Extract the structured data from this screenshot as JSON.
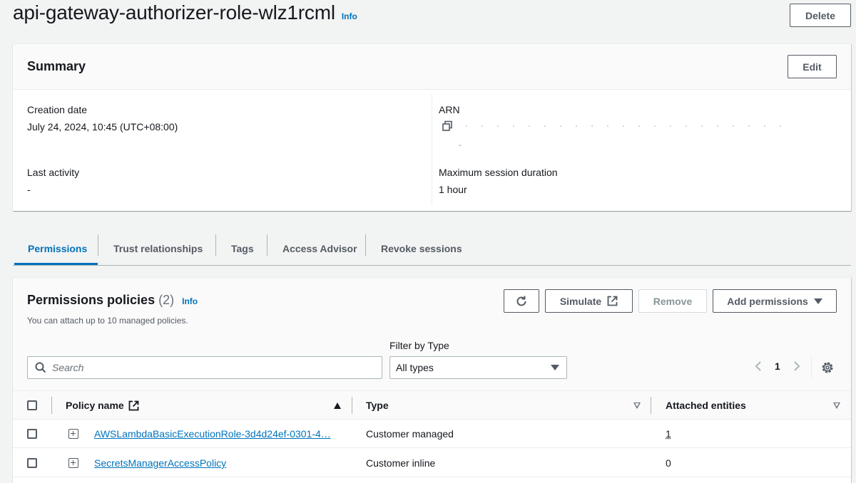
{
  "header": {
    "title": "api-gateway-authorizer-role-wlz1rcml",
    "info": "Info",
    "delete_label": "Delete"
  },
  "summary": {
    "title": "Summary",
    "edit_label": "Edit",
    "creation_date_label": "Creation date",
    "creation_date_value": "July 24, 2024, 10:45 (UTC+08:00)",
    "last_activity_label": "Last activity",
    "last_activity_value": "-",
    "arn_label": "ARN",
    "max_session_label": "Maximum session duration",
    "max_session_value": "1 hour"
  },
  "tabs": [
    {
      "label": "Permissions",
      "active": true
    },
    {
      "label": "Trust relationships"
    },
    {
      "label": "Tags"
    },
    {
      "label": "Access Advisor"
    },
    {
      "label": "Revoke sessions"
    }
  ],
  "policies": {
    "title": "Permissions policies",
    "count": "(2)",
    "info": "Info",
    "description": "You can attach up to 10 managed policies.",
    "simulate_label": "Simulate",
    "remove_label": "Remove",
    "add_permissions_label": "Add permissions",
    "filter_label": "Filter by Type",
    "search_placeholder": "Search",
    "filter_value": "All types",
    "page": "1",
    "columns": {
      "policy_name": "Policy name",
      "type": "Type",
      "attached": "Attached entities"
    },
    "rows": [
      {
        "name": "AWSLambdaBasicExecutionRole-3d4d24ef-0301-4…",
        "type": "Customer managed",
        "attached": "1"
      },
      {
        "name": "SecretsManagerAccessPolicy",
        "type": "Customer inline",
        "attached": "0"
      }
    ]
  },
  "colors": {
    "accent": "#0073bb",
    "text": "#16191f",
    "background": "#f2f3f3"
  }
}
